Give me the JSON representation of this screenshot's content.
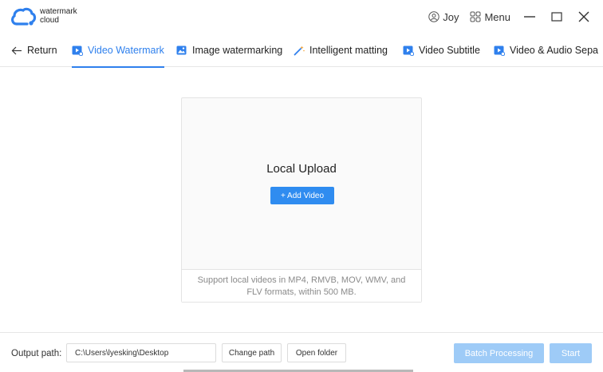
{
  "app": {
    "logo_line1": "watermark",
    "logo_line2": "cloud",
    "user_name": "Joy",
    "menu_label": "Menu"
  },
  "tabs": [
    {
      "label": "Return",
      "icon": "arrow-left-icon"
    },
    {
      "label": "Video Watermark",
      "icon": "video-icon",
      "active": true
    },
    {
      "label": "Image watermarking",
      "icon": "image-icon"
    },
    {
      "label": "Intelligent matting",
      "icon": "magic-wand-icon"
    },
    {
      "label": "Video Subtitle",
      "icon": "video-icon"
    },
    {
      "label": "Video & Audio Sepa",
      "icon": "video-icon"
    }
  ],
  "upload": {
    "title": "Local Upload",
    "add_button": "+ Add Video",
    "note_line1": "Support local videos in MP4, RMVB, MOV, WMV, and",
    "note_line2": "FLV formats,  within 500 MB."
  },
  "bottom": {
    "output_label": "Output path:",
    "output_path": "C:\\Users\\lyesking\\Desktop",
    "change_path": "Change path",
    "open_folder": "Open folder",
    "batch_processing": "Batch Processing",
    "start": "Start"
  },
  "colors": {
    "accent": "#2f80ed",
    "button_primary": "#2f8cf0",
    "button_disabled": "#9ecbf7"
  }
}
